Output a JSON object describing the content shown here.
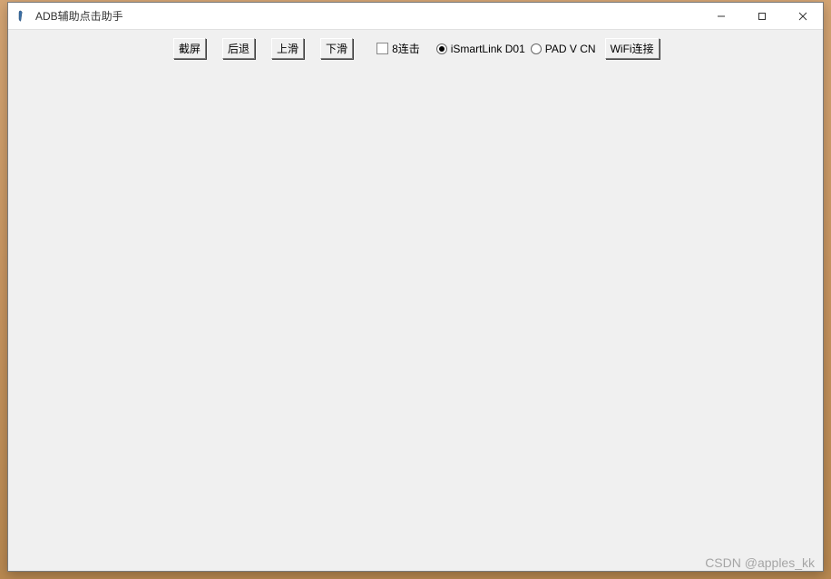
{
  "window": {
    "title": "ADB辅助点击助手"
  },
  "toolbar": {
    "buttons": {
      "screenshot": "截屏",
      "back": "后退",
      "swipe_up": "上滑",
      "swipe_down": "下滑",
      "wifi_connect": "WiFi连接"
    },
    "checkbox": {
      "eight_click": "8连击"
    },
    "radio": {
      "ismartlink": "iSmartLink D01",
      "pad_v_cn": "PAD V CN"
    }
  },
  "watermark": "CSDN @apples_kk"
}
